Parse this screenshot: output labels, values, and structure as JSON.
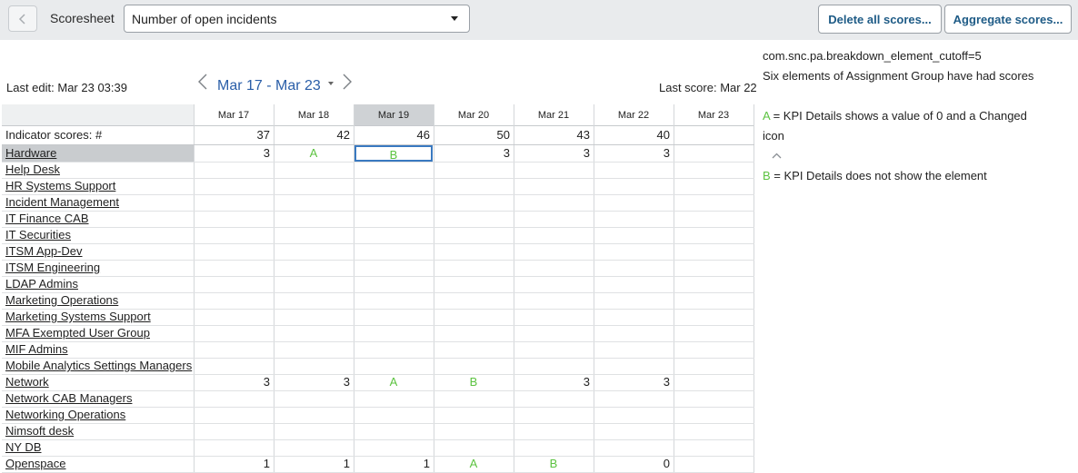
{
  "toolbar": {
    "back_icon": "chevron-left-icon",
    "label": "Scoresheet",
    "select_value": "Number of open incidents",
    "delete_label": "Delete all scores...",
    "aggregate_label": "Aggregate scores..."
  },
  "header": {
    "last_edit": "Last edit: Mar 23 03:39",
    "range": "Mar 17 - Mar 23",
    "last_score": "Last score: Mar 22"
  },
  "table": {
    "columns": [
      "Mar 17",
      "Mar 18",
      "Mar 19",
      "Mar 20",
      "Mar 21",
      "Mar 22",
      "Mar 23"
    ],
    "selected_column": "Mar 19",
    "indicator": {
      "label": "Indicator scores: #",
      "values": [
        "37",
        "42",
        "46",
        "50",
        "43",
        "40",
        ""
      ]
    },
    "rows": [
      {
        "label": "Hardware",
        "cells": [
          "3",
          "A",
          "B",
          "3",
          "3",
          "3",
          ""
        ]
      },
      {
        "label": "Help Desk",
        "cells": [
          "",
          "",
          "",
          "",
          "",
          "",
          ""
        ]
      },
      {
        "label": "HR Systems Support",
        "cells": [
          "",
          "",
          "",
          "",
          "",
          "",
          ""
        ]
      },
      {
        "label": "Incident Management",
        "cells": [
          "",
          "",
          "",
          "",
          "",
          "",
          ""
        ]
      },
      {
        "label": "IT Finance CAB",
        "cells": [
          "",
          "",
          "",
          "",
          "",
          "",
          ""
        ]
      },
      {
        "label": "IT Securities",
        "cells": [
          "",
          "",
          "",
          "",
          "",
          "",
          ""
        ]
      },
      {
        "label": "ITSM App-Dev",
        "cells": [
          "",
          "",
          "",
          "",
          "",
          "",
          ""
        ]
      },
      {
        "label": "ITSM Engineering",
        "cells": [
          "",
          "",
          "",
          "",
          "",
          "",
          ""
        ]
      },
      {
        "label": "LDAP Admins",
        "cells": [
          "",
          "",
          "",
          "",
          "",
          "",
          ""
        ]
      },
      {
        "label": "Marketing Operations",
        "cells": [
          "",
          "",
          "",
          "",
          "",
          "",
          ""
        ]
      },
      {
        "label": "Marketing Systems Support",
        "cells": [
          "",
          "",
          "",
          "",
          "",
          "",
          ""
        ]
      },
      {
        "label": "MFA Exempted User Group",
        "cells": [
          "",
          "",
          "",
          "",
          "",
          "",
          ""
        ]
      },
      {
        "label": "MIF Admins",
        "cells": [
          "",
          "",
          "",
          "",
          "",
          "",
          ""
        ]
      },
      {
        "label": "Mobile Analytics Settings Managers",
        "cells": [
          "",
          "",
          "",
          "",
          "",
          "",
          ""
        ]
      },
      {
        "label": "Network",
        "cells": [
          "3",
          "3",
          "A",
          "B",
          "3",
          "3",
          ""
        ]
      },
      {
        "label": "Network CAB Managers",
        "cells": [
          "",
          "",
          "",
          "",
          "",
          "",
          ""
        ]
      },
      {
        "label": "Networking Operations",
        "cells": [
          "",
          "",
          "",
          "",
          "",
          "",
          ""
        ]
      },
      {
        "label": "Nimsoft desk",
        "cells": [
          "",
          "",
          "",
          "",
          "",
          "",
          ""
        ]
      },
      {
        "label": "NY DB",
        "cells": [
          "",
          "",
          "",
          "",
          "",
          "",
          ""
        ]
      },
      {
        "label": "Openspace",
        "cells": [
          "1",
          "1",
          "1",
          "A",
          "B",
          "0",
          ""
        ]
      }
    ]
  },
  "notes": {
    "cutoff": "com.snc.pa.breakdown_element_cutoff=5",
    "summary": "Six elements of Assignment Group have had scores",
    "a_key": "A",
    "a_text_line1": " = KPI Details shows a value of 0 and a Changed",
    "a_text_line2": "icon",
    "b_key": "B",
    "b_text": " = KPI Details does not show the element",
    "chevron_icon": "chevron-up-icon"
  },
  "colors": {
    "accent_blue": "#2a5ea8",
    "button_text": "#1e5b86",
    "marker_green": "#5cc341",
    "selected_column": "#cfd2d5"
  }
}
